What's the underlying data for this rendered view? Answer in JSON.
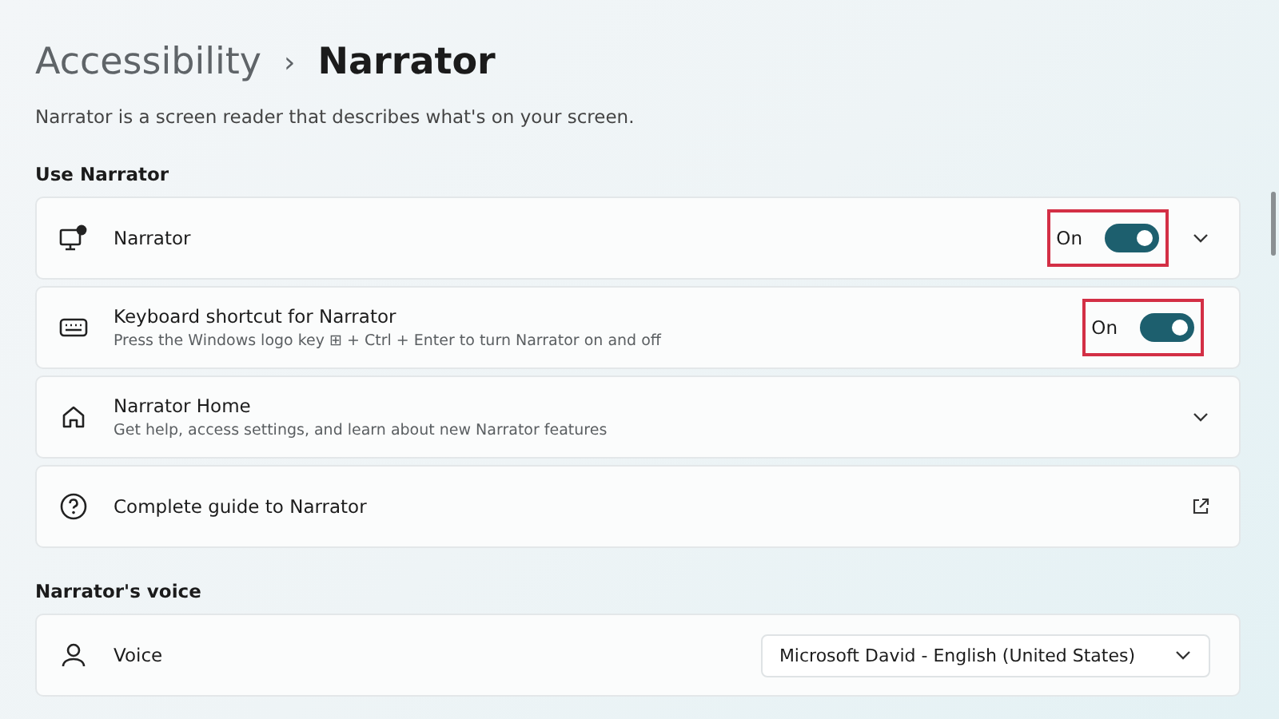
{
  "breadcrumb": {
    "parent": "Accessibility",
    "separator": "›",
    "current": "Narrator"
  },
  "description": "Narrator is a screen reader that describes what's on your screen.",
  "sections": [
    {
      "heading": "Use Narrator",
      "rows": [
        {
          "kind": "toggle",
          "title": "Narrator",
          "toggle_label": "On",
          "on": true,
          "highlighted": true,
          "expandable": true
        },
        {
          "kind": "toggle",
          "title": "Keyboard shortcut for Narrator",
          "subtitle": "Press the Windows logo key ⊞ + Ctrl + Enter to turn Narrator on and off",
          "toggle_label": "On",
          "on": true,
          "highlighted": true,
          "expandable": false
        },
        {
          "kind": "expand",
          "title": "Narrator Home",
          "subtitle": "Get help, access settings, and learn about new Narrator features"
        },
        {
          "kind": "link",
          "title": "Complete guide to Narrator"
        }
      ]
    },
    {
      "heading": "Narrator's voice",
      "rows": [
        {
          "kind": "dropdown",
          "title": "Voice",
          "value": "Microsoft David - English (United States)"
        }
      ]
    }
  ]
}
